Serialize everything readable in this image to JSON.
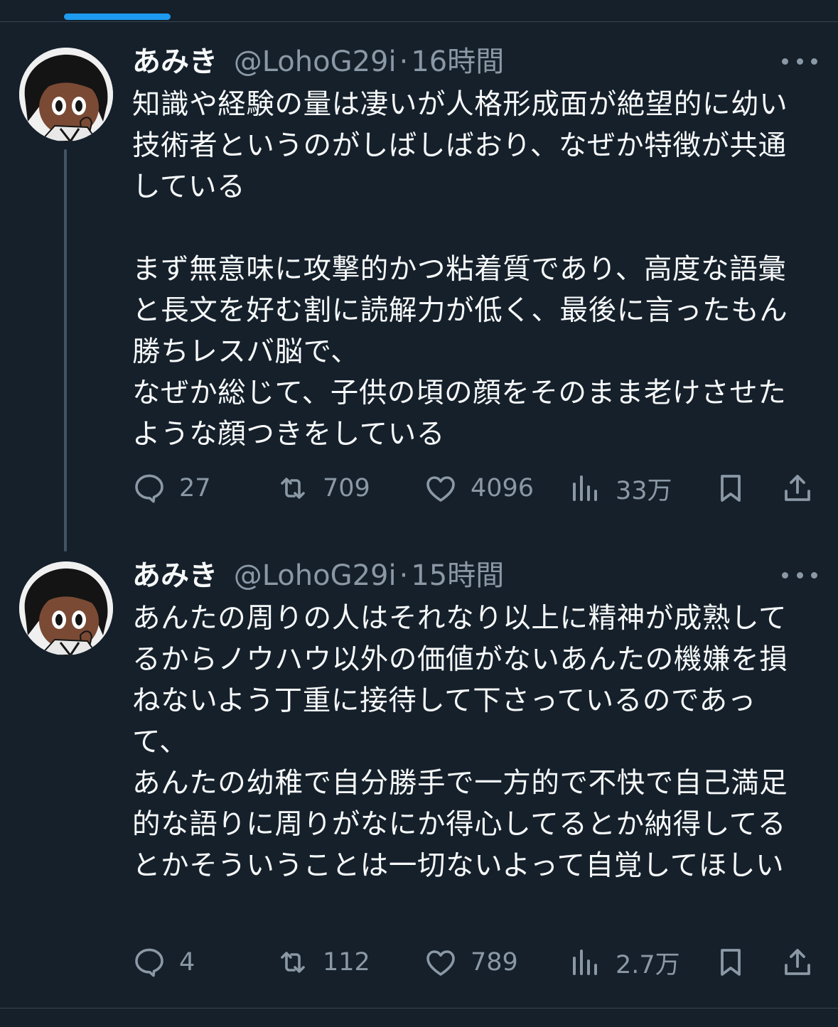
{
  "tweets": [
    {
      "display_name": "あみき",
      "handle": "@LohoG29i",
      "separator": "·",
      "time": "16時間",
      "body": [
        "知識や経験の量は凄いが人格形成面が絶望的に幼い技術者というのがしばしばおり、なぜか特徴が共通している",
        "まず無意味に攻撃的かつ粘着質であり、高度な語彙と長文を好む割に読解力が低く、最後に言ったもん勝ちレスバ脳で、\nなぜか総じて、子供の頃の顔をそのまま老けさせたような顔つきをしている"
      ],
      "replies": "27",
      "retweets": "709",
      "likes": "4096",
      "views": "33万"
    },
    {
      "display_name": "あみき",
      "handle": "@LohoG29i",
      "separator": "·",
      "time": "15時間",
      "body": [
        "あんたの周りの人はそれなり以上に精神が成熟してるからノウハウ以外の価値がないあんたの機嫌を損ねないよう丁重に接待して下さっているのであって、\nあんたの幼稚で自分勝手で一方的で不快で自己満足的な語りに周りがなにか得心してるとか納得してるとかそういうことは一切ないよって自覚してほしい"
      ],
      "replies": "4",
      "retweets": "112",
      "likes": "789",
      "views": "2.7万"
    }
  ],
  "icons": {
    "reply": "speech-bubble-icon",
    "retweet": "retweet-arrows-icon",
    "like": "heart-icon",
    "views": "bar-chart-icon",
    "bookmark": "bookmark-icon",
    "share": "share-upload-icon",
    "more": "more-dots-icon"
  },
  "colors": {
    "background": "#15202b",
    "text": "#f7f9f9",
    "secondary": "#8b98a5",
    "accent": "#1d9bf0",
    "divider": "#38444d"
  }
}
